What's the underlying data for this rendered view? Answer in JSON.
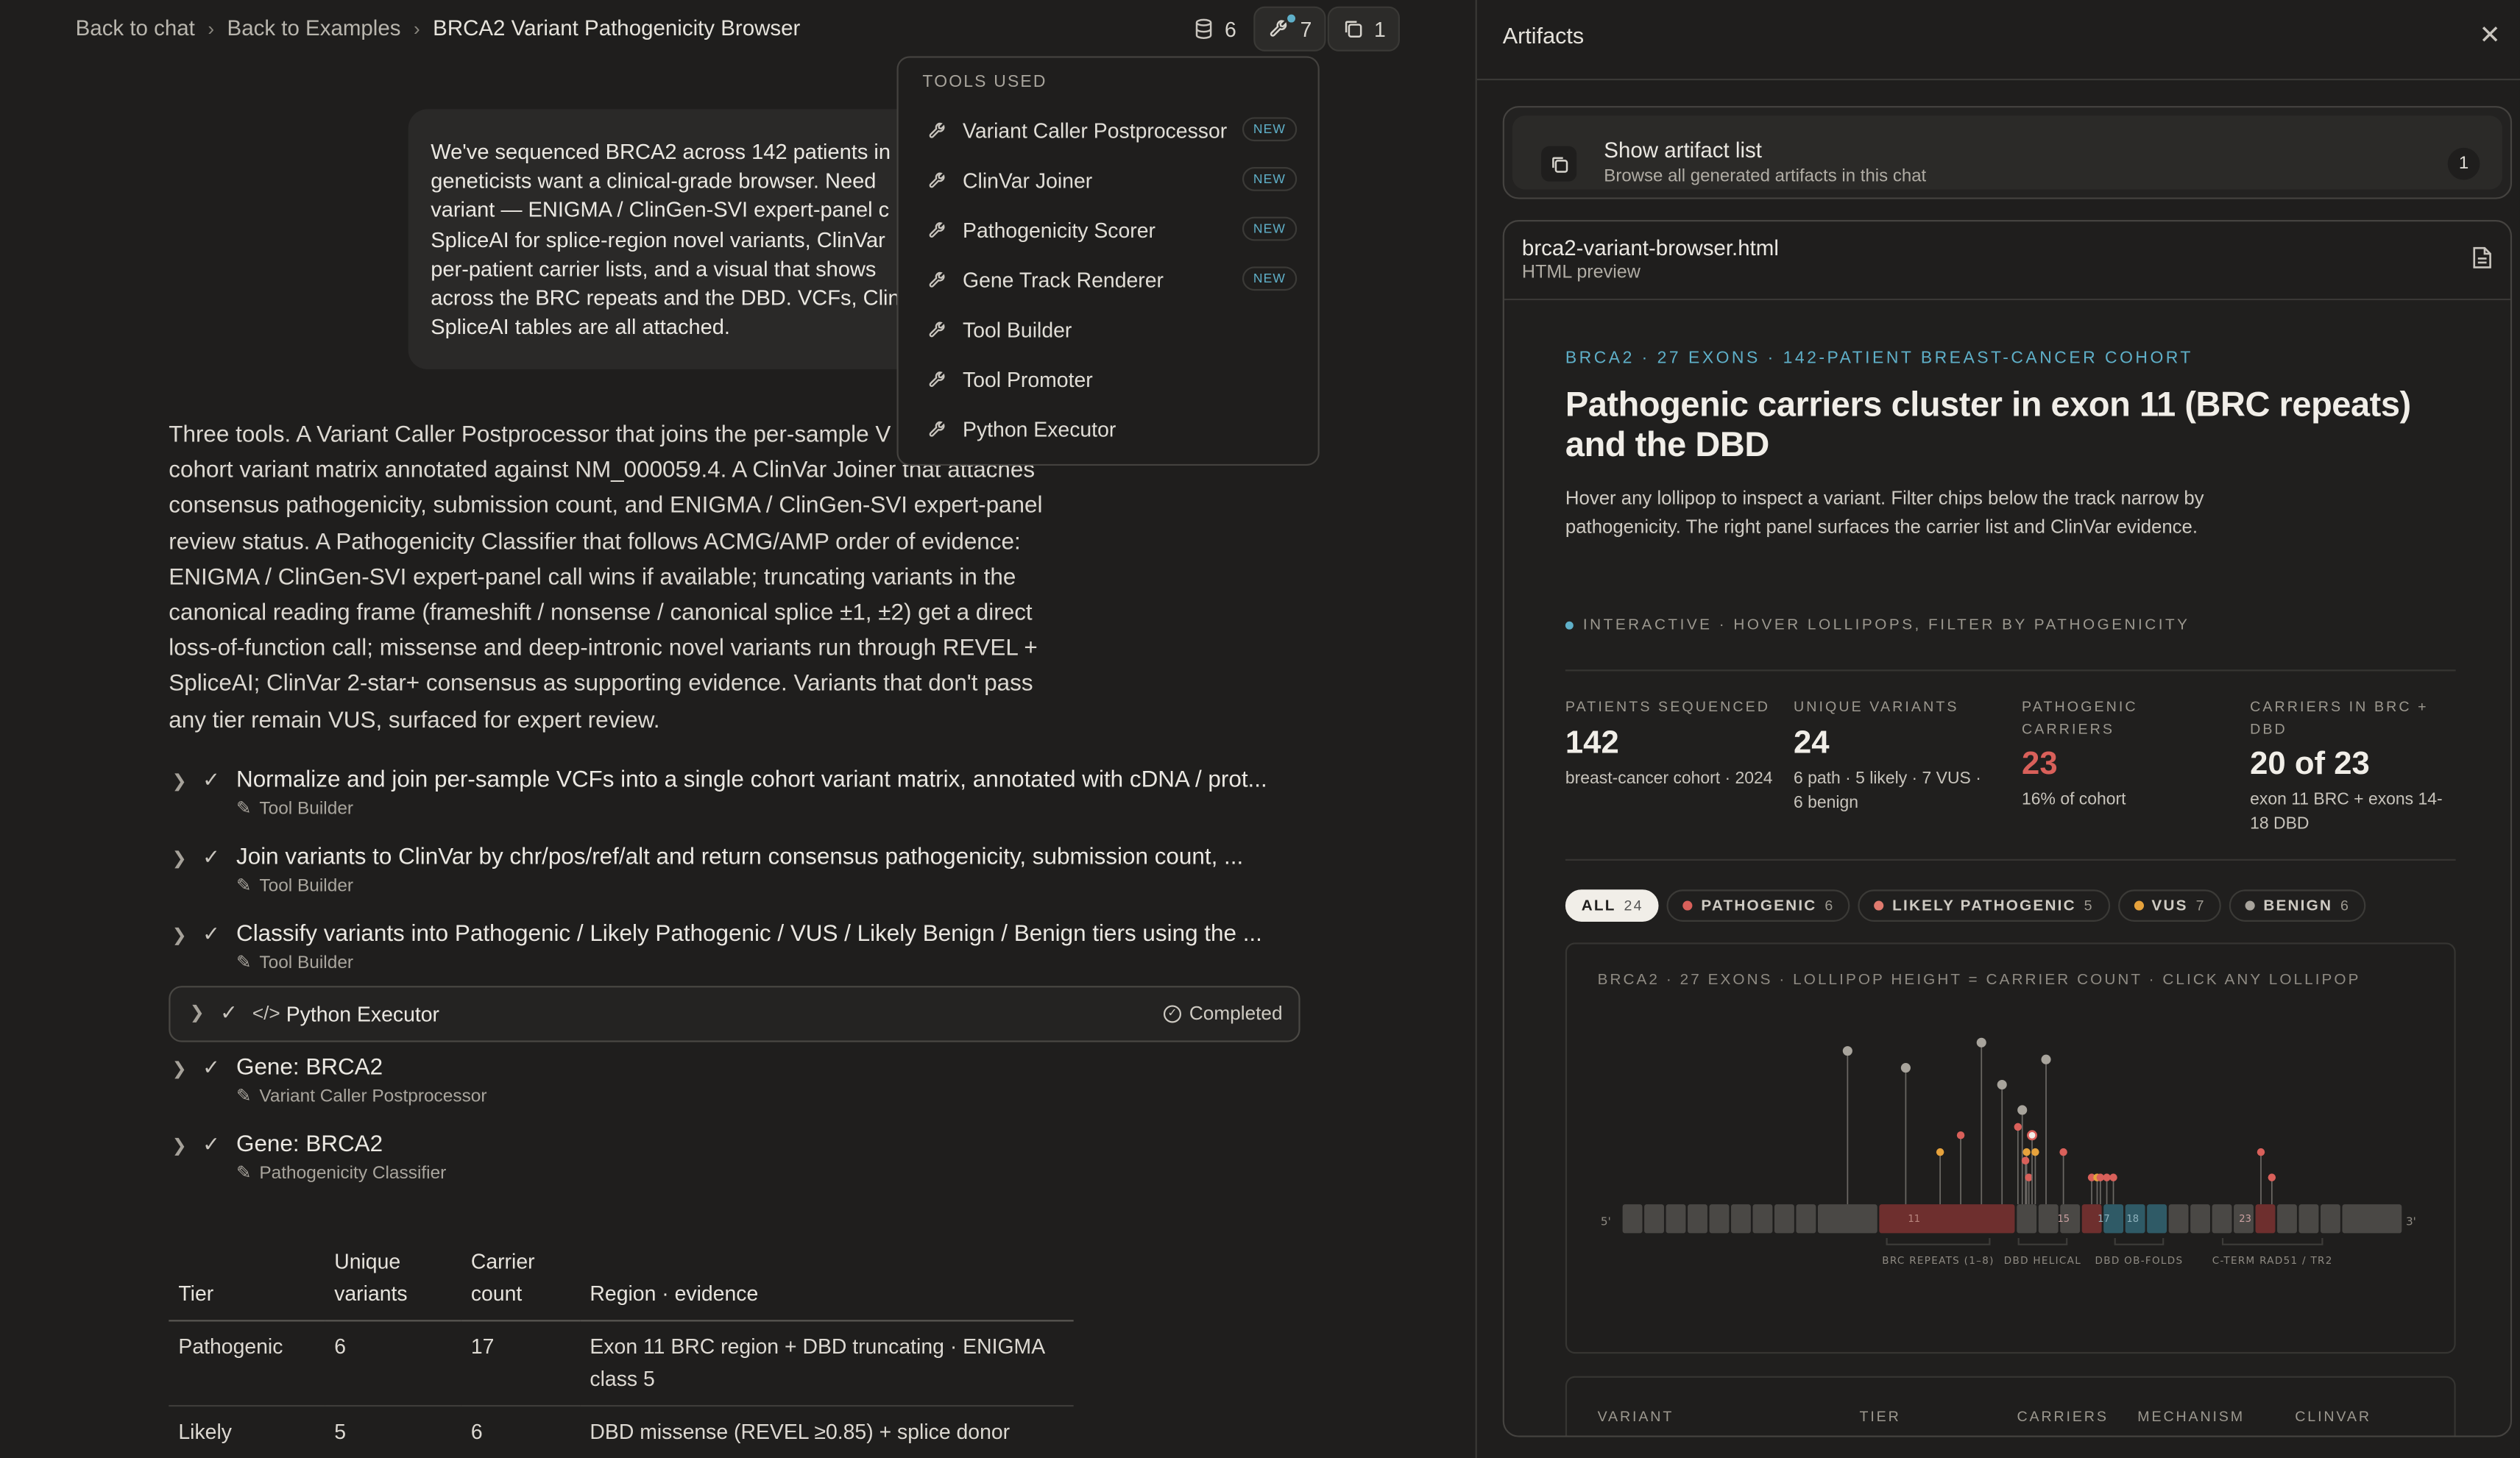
{
  "breadcrumb": {
    "back_chat": "Back to chat",
    "back_examples": "Back to Examples",
    "current": "BRCA2 Variant Pathogenicity Browser",
    "sep": "›"
  },
  "toolbar": {
    "db_count": "6",
    "tools_count": "7",
    "artifacts_count": "1"
  },
  "tools_menu": {
    "header": "TOOLS USED",
    "new_badge": "NEW",
    "items": [
      {
        "label": "Variant Caller Postprocessor",
        "new": true
      },
      {
        "label": "ClinVar Joiner",
        "new": true
      },
      {
        "label": "Pathogenicity Scorer",
        "new": true
      },
      {
        "label": "Gene Track Renderer",
        "new": true
      },
      {
        "label": "Tool Builder",
        "new": false
      },
      {
        "label": "Tool Promoter",
        "new": false
      },
      {
        "label": "Python Executor",
        "new": false
      }
    ]
  },
  "chat": {
    "user_lines": [
      "We've sequenced BRCA2 across 142 patients in",
      "geneticists want a clinical-grade browser. Need",
      "variant — ENIGMA / ClinGen-SVI expert-panel c",
      "SpliceAI for splice-region novel variants, ClinVar",
      "per-patient carrier lists, and a visual that shows",
      "across the BRC repeats and the DBD. VCFs, Clin",
      "SpliceAI tables are all attached."
    ],
    "assistant_lines": [
      "Three tools. A Variant Caller Postprocessor that joins the per-sample V",
      "cohort variant matrix annotated against NM_000059.4. A ClinVar Joiner that attaches",
      "consensus pathogenicity, submission count, and ENIGMA / ClinGen-SVI expert-panel",
      "review status. A Pathogenicity Classifier that follows ACMG/AMP order of evidence:",
      "ENIGMA / ClinGen-SVI expert-panel call wins if available; truncating variants in the",
      "canonical reading frame (frameshift / nonsense / canonical splice ±1, ±2) get a direct",
      "loss-of-function call; missense and deep-intronic novel variants run through REVEL +",
      "SpliceAI; ClinVar 2-star+ consensus as supporting evidence. Variants that don't pass",
      "any tier remain VUS, surfaced for expert review."
    ],
    "steps": [
      {
        "title": "Normalize and join per-sample VCFs into a single cohort variant matrix, annotated with cDNA / prot...",
        "tool": "Tool Builder"
      },
      {
        "title": "Join variants to ClinVar by chr/pos/ref/alt and return consensus pathogenicity, submission count, ...",
        "tool": "Tool Builder"
      },
      {
        "title": "Classify variants into Pathogenic / Likely Pathogenic / VUS / Likely Benign / Benign tiers using the ...",
        "tool": "Tool Builder"
      },
      {
        "title": "Gene: BRCA2",
        "tool": "Variant Caller Postprocessor"
      },
      {
        "title": "Gene: BRCA2",
        "tool": "Pathogenicity Classifier"
      }
    ],
    "python_exec": {
      "label": "Python Executor",
      "status": "Completed"
    },
    "table": {
      "headers": [
        "Tier",
        "Unique variants",
        "Carrier count",
        "Region · evidence"
      ],
      "rows": [
        [
          "Pathogenic",
          "6",
          "17",
          "Exon 11 BRC region + DBD truncating · ENIGMA class 5"
        ],
        [
          "Likely",
          "5",
          "6",
          "DBD missense (REVEL ≥0.85) + splice donor"
        ]
      ]
    }
  },
  "artifacts": {
    "title": "Artifacts",
    "list_title": "Show artifact list",
    "list_sub": "Browse all generated artifacts in this chat",
    "list_count": "1",
    "file_name": "brca2-variant-browser.html",
    "file_type": "HTML preview"
  },
  "preview": {
    "eyebrow": "BRCA2 · 27 EXONS · 142-PATIENT BREAST-CANCER COHORT",
    "title": "Pathogenic carriers cluster in exon 11 (BRC repeats) and the DBD",
    "desc": "Hover any lollipop to inspect a variant. Filter chips below the track narrow by pathogenicity. The right panel surfaces the carrier list and ClinVar evidence.",
    "interactive": "INTERACTIVE · HOVER LOLLIPOPS, FILTER BY PATHOGENICITY",
    "stats": [
      {
        "label": "PATIENTS SEQUENCED",
        "value": "142",
        "note": "breast-cancer cohort · 2024"
      },
      {
        "label": "UNIQUE VARIANTS",
        "value": "24",
        "note": "6 path · 5 likely · 7 VUS · 6 benign"
      },
      {
        "label": "PATHOGENIC CARRIERS",
        "value": "23",
        "note": "16% of cohort"
      },
      {
        "label": "CARRIERS IN BRC + DBD",
        "value": "20 of 23",
        "note": "exon 11 BRC + exons 14-18 DBD"
      }
    ],
    "chips": [
      {
        "label": "ALL",
        "count": "24",
        "color": ""
      },
      {
        "label": "PATHOGENIC",
        "count": "6",
        "color": "#d9605a"
      },
      {
        "label": "LIKELY PATHOGENIC",
        "count": "5",
        "color": "#e07a6e"
      },
      {
        "label": "VUS",
        "count": "7",
        "color": "#e6a23c"
      },
      {
        "label": "BENIGN",
        "count": "6",
        "color": "#a8a49c"
      }
    ],
    "track_header": "BRCA2 · 27 EXONS · LOLLIPOP HEIGHT = CARRIER COUNT · CLICK ANY LOLLIPOP",
    "track_ends": {
      "five": "5'",
      "three": "3'"
    },
    "domains": [
      "BRC REPEATS (1–8)",
      "DBD HELICAL",
      "DBD OB-FOLDS",
      "C-TERM RAD51 / TR2"
    ],
    "exon_labels": [
      "11",
      "15",
      "17",
      "18",
      "23"
    ],
    "variant_headers": [
      "VARIANT",
      "TIER",
      "CARRIERS",
      "MECHANISM",
      "CLINVAR"
    ],
    "colors": {
      "pathogenic": "#d9605a",
      "likely": "#e07a6e",
      "vus": "#e6a23c",
      "benign": "#a8a49c",
      "accent": "#5fb0c9",
      "brc": "#6e2f2e",
      "dbd": "#2f5a66",
      "cterm": "#6e2f2e"
    }
  },
  "chart_data": {
    "type": "lollipop",
    "title": "BRCA2 · 27 EXONS · LOLLIPOP HEIGHT = CARRIER COUNT · CLICK ANY LOLLIPOP",
    "exons": 27,
    "variants": [
      {
        "exon": 10,
        "tier": "benign",
        "carriers": 9
      },
      {
        "exon": 11.2,
        "tier": "benign",
        "carriers": 8
      },
      {
        "exon": 11.45,
        "tier": "vus",
        "carriers": 3
      },
      {
        "exon": 11.6,
        "tier": "pathogenic",
        "carriers": 4
      },
      {
        "exon": 11.75,
        "tier": "benign",
        "carriers": 9.5
      },
      {
        "exon": 11.9,
        "tier": "benign",
        "carriers": 7
      },
      {
        "exon": 12.0,
        "tier": "vus",
        "carriers": 3
      },
      {
        "exon": 12.1,
        "tier": "pathogenic",
        "carriers": 4.5
      },
      {
        "exon": 12.3,
        "tier": "benign",
        "carriers": 5.5
      },
      {
        "exon": 12.45,
        "tier": "pathogenic",
        "carriers": 2.5
      },
      {
        "exon": 12.6,
        "tier": "pathogenic",
        "carriers": 1.5
      },
      {
        "exon": 12.75,
        "tier": "selected",
        "carriers": 4
      },
      {
        "exon": 12.9,
        "tier": "vus",
        "carriers": 3
      },
      {
        "exon": 13.4,
        "tier": "benign",
        "carriers": 8.5
      },
      {
        "exon": 14.2,
        "tier": "pathogenic",
        "carriers": 3
      },
      {
        "exon": 15.5,
        "tier": "pathogenic",
        "carriers": 1.5
      },
      {
        "exon": 15.75,
        "tier": "vus",
        "carriers": 1.5
      },
      {
        "exon": 15.9,
        "tier": "pathogenic",
        "carriers": 1.5
      },
      {
        "exon": 16.2,
        "tier": "pathogenic",
        "carriers": 1.5
      },
      {
        "exon": 16.5,
        "tier": "pathogenic",
        "carriers": 1.5
      },
      {
        "exon": 23.3,
        "tier": "pathogenic",
        "carriers": 3
      },
      {
        "exon": 23.8,
        "tier": "pathogenic",
        "carriers": 1.5
      }
    ]
  }
}
